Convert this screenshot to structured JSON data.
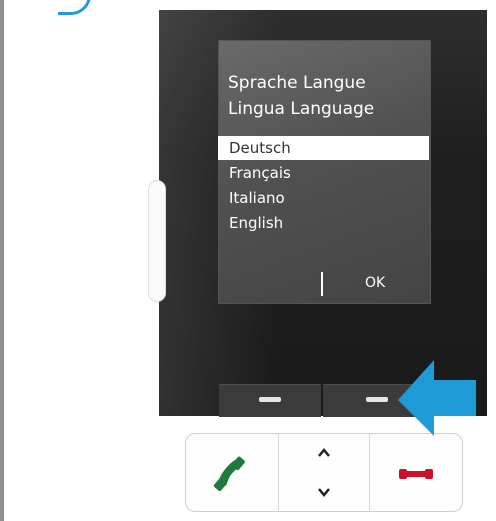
{
  "screen": {
    "title_line1": "Sprache Langue",
    "title_line2": "Lingua Language",
    "languages": [
      "Deutsch",
      "Français",
      "Italiano",
      "English"
    ],
    "selected_index": 0,
    "right_softkey": "OK"
  },
  "colors": {
    "call_green": "#1f7a3d",
    "end_red": "#d0102a",
    "highlight_arrow": "#1e9ad6"
  },
  "icons": {
    "call": "phone-call-icon",
    "end": "phone-end-icon",
    "up": "chevron-up-icon",
    "down": "chevron-down-icon"
  }
}
